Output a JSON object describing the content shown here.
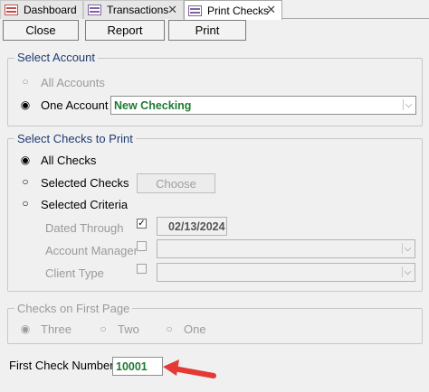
{
  "tabs": [
    {
      "label": "Dashboard"
    },
    {
      "label": "Transactions",
      "close": "✕"
    },
    {
      "label": "Print Checks",
      "close": "✕"
    }
  ],
  "toolbar": {
    "close_label": "Close",
    "report_label": "Report",
    "print_label": "Print"
  },
  "select_account": {
    "legend": "Select Account",
    "all_accounts_label": "All Accounts",
    "one_account_label": "One Account",
    "account_value": "New Checking",
    "selected": "One Account"
  },
  "select_checks": {
    "legend": "Select Checks to Print",
    "all_checks_label": "All Checks",
    "selected_checks_label": "Selected Checks",
    "choose_label": "Choose",
    "selected_criteria_label": "Selected Criteria",
    "dated_through_label": "Dated Through",
    "dated_through_value": "02/13/2024",
    "dated_through_checked": true,
    "account_manager_label": "Account Manager",
    "client_type_label": "Client Type",
    "selected": "All Checks"
  },
  "checks_first_page": {
    "legend": "Checks on First Page",
    "three_label": "Three",
    "two_label": "Two",
    "one_label": "One",
    "selected": "Three"
  },
  "first_check": {
    "label": "First Check Number",
    "value": "10001"
  },
  "colors": {
    "accent_green": "#1f7a33",
    "legend_blue": "#1f3b73",
    "arrow_red": "#e53935"
  }
}
